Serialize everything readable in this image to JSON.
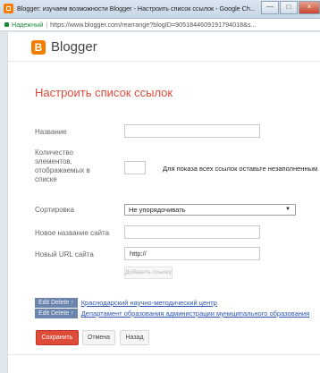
{
  "window": {
    "title": "Blogger: изучаем возможности Blogger - Настроить список ссылок - Google Ch...",
    "buttons": {
      "minimize": "—",
      "maximize": "□",
      "close": "×"
    }
  },
  "addressbar": {
    "secure_label": "Надежный",
    "separator": "|",
    "url": "https://www.blogger.com/rearrange?blogID=9051844609191794018&s..."
  },
  "header": {
    "brand": "Blogger",
    "logo_letter": "B"
  },
  "form": {
    "heading": "Настроить список ссылок",
    "name_label": "Название",
    "name_value": "",
    "count_label": "Количество элементов, отображаемых в списке",
    "count_value": "",
    "count_hint": "Для показа всех ссылок оставьте незаполненным",
    "sort_label": "Сортировка",
    "sort_value": "Не упорядочивать",
    "sort_arrow": "▼",
    "new_site_name_label": "Новое название сайта",
    "new_site_name_value": "",
    "new_url_label": "Новый URL сайта",
    "new_url_value": "http://",
    "add_link_button": "Добавить ссылку"
  },
  "links": [
    {
      "edit_delete": "Edit Delete ↑",
      "text": "Краснодарский научно-методический центр"
    },
    {
      "edit_delete": "Edit Delete ↑",
      "text": "Департамент образования администрации муниципального образования"
    }
  ],
  "actions": {
    "save": "Сохранить",
    "cancel": "Отмена",
    "back": "Назад"
  }
}
